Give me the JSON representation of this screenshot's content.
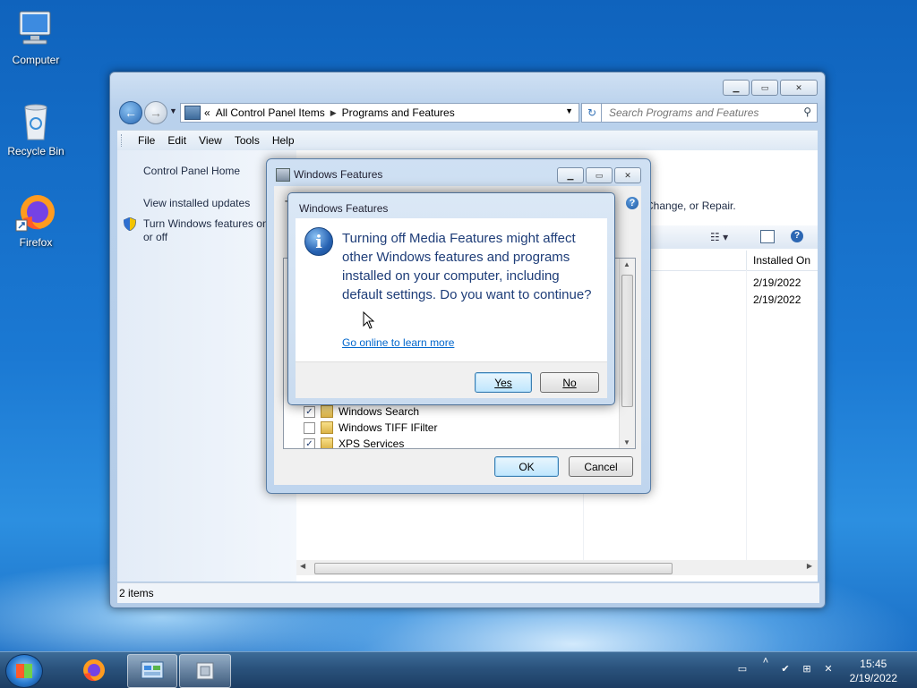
{
  "desktop": {
    "icons": [
      {
        "label": "Computer"
      },
      {
        "label": "Recycle Bin"
      },
      {
        "label": "Firefox"
      }
    ]
  },
  "main_window": {
    "address": {
      "prefix": "«",
      "crumb1": "All Control Panel Items",
      "crumb2": "Programs and Features"
    },
    "search_placeholder": "Search Programs and Features",
    "menu": [
      "File",
      "Edit",
      "View",
      "Tools",
      "Help"
    ],
    "left_pane": {
      "home": "Control Panel Home",
      "installed_updates": "View installed updates",
      "features_link": "Turn Windows features on or off"
    },
    "content": {
      "header_fragment": "Change, or Repair.",
      "column_installed_on": "Installed On",
      "rows": [
        {
          "installed_on": "2/19/2022"
        },
        {
          "installed_on": "2/19/2022"
        }
      ]
    },
    "status": "2 items"
  },
  "features_dialog": {
    "title": "Windows Features",
    "visible_text_fragment": "T",
    "tree_items": [
      {
        "label": "Windows Search",
        "checked": true
      },
      {
        "label": "Windows TIFF IFilter",
        "checked": false
      },
      {
        "label": "XPS Services",
        "checked": true
      }
    ],
    "ok": "OK",
    "cancel": "Cancel"
  },
  "confirm_dialog": {
    "title": "Windows Features",
    "message": "Turning off Media Features might affect other Windows features and programs installed on your computer, including default settings. Do you want to continue?",
    "link": "Go online to learn more",
    "yes": "Yes",
    "no": "No"
  },
  "taskbar": {
    "time": "15:45",
    "date": "2/19/2022"
  },
  "colors": {
    "link": "#0066cc",
    "message_text": "#1e3d78",
    "taskbar": "#2a527c"
  }
}
